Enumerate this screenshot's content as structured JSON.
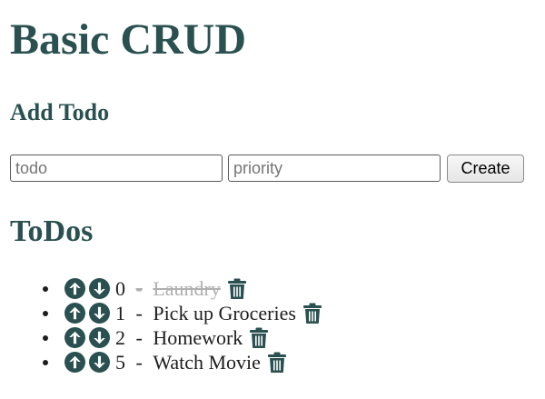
{
  "header": {
    "title": "Basic CRUD"
  },
  "add_form": {
    "heading": "Add Todo",
    "todo_placeholder": "todo",
    "priority_placeholder": "priority",
    "create_label": "Create"
  },
  "todos_section": {
    "heading": "ToDos",
    "items": [
      {
        "priority": "0",
        "separator": "-",
        "text": "Laundry",
        "completed": true
      },
      {
        "priority": "1",
        "separator": "-",
        "text": "Pick up Groceries",
        "completed": false
      },
      {
        "priority": "2",
        "separator": "-",
        "text": "Homework",
        "completed": false
      },
      {
        "priority": "5",
        "separator": "-",
        "text": "Watch Movie",
        "completed": false
      }
    ]
  },
  "icons": {
    "up": "arrow-circle-up-icon",
    "down": "arrow-circle-down-icon",
    "delete": "trash-icon"
  },
  "colors": {
    "accent": "#2a5050",
    "completed_text": "#b0b0b0"
  }
}
